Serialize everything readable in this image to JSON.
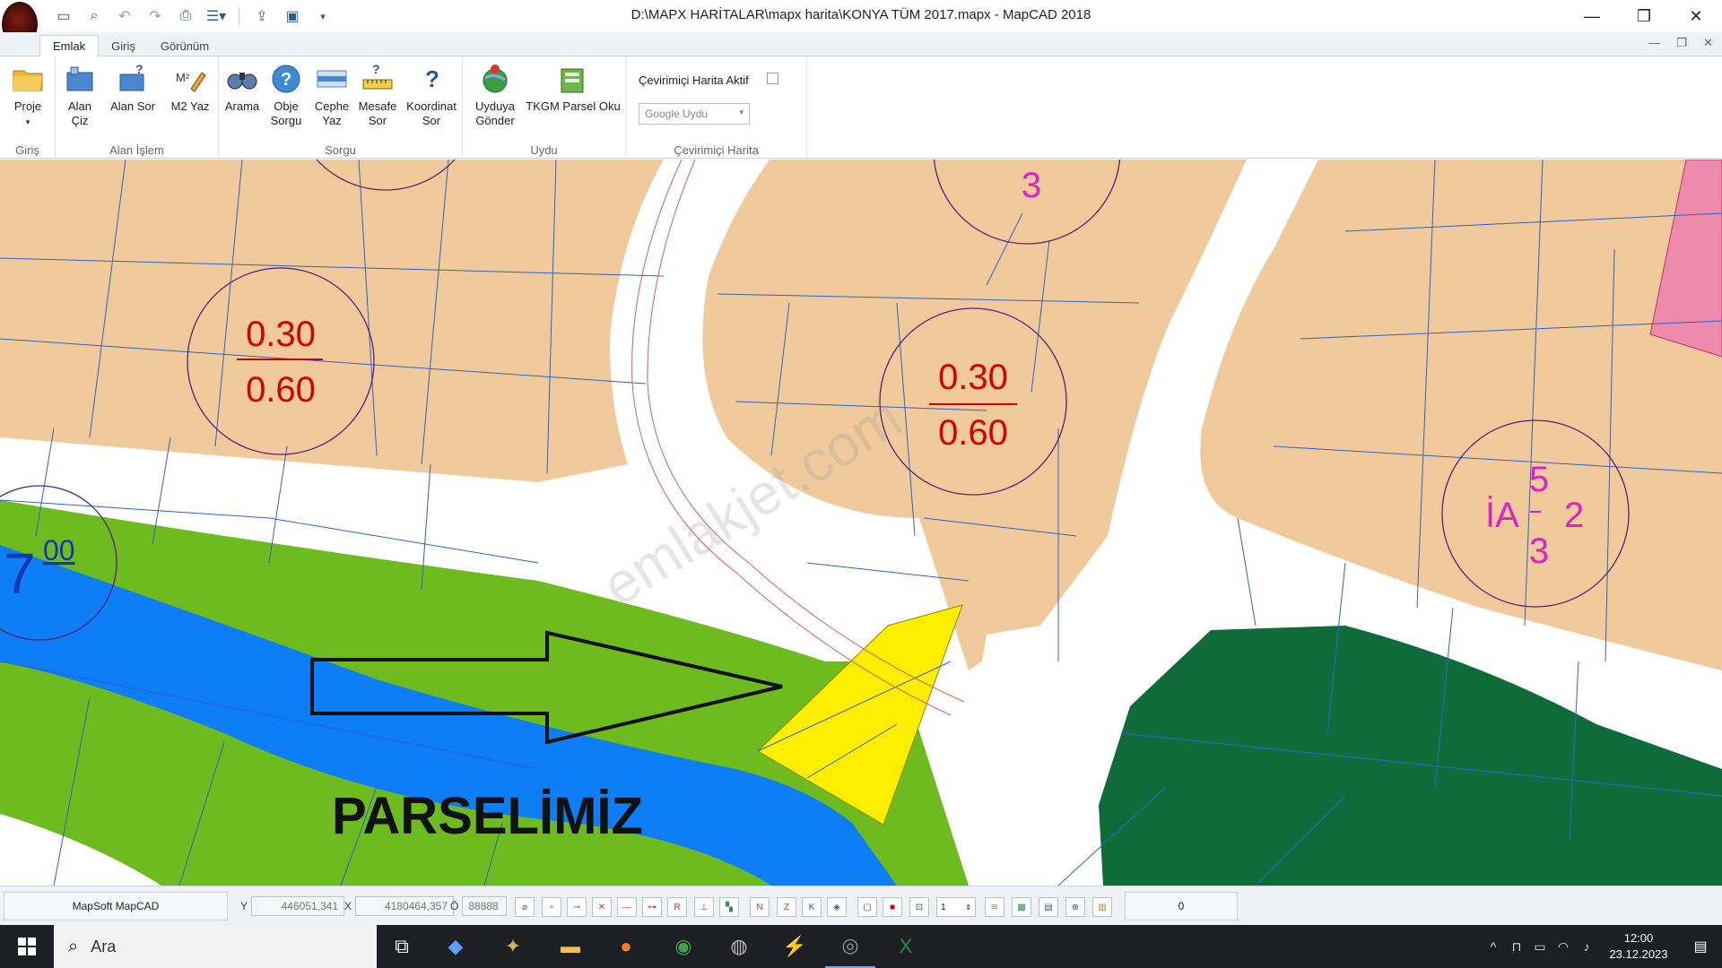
{
  "window": {
    "title": "D:\\MAPX HARİTALAR\\mapx harita\\KONYA TÜM 2017.mapx - MapCAD 2018",
    "minimize": "—",
    "restore": "❐",
    "close": "✕"
  },
  "ribbon_tabs": [
    "Emlak",
    "Giriş",
    "Görünüm"
  ],
  "ribbon": {
    "groups": {
      "giris": "Giriş",
      "alan_islem": "Alan İşlem",
      "sorgu": "Sorgu",
      "uydu": "Uydu",
      "cevrimici": "Çevirimiçi Harita"
    },
    "buttons": {
      "proje": "Proje",
      "alan_ciz": "Alan Çiz",
      "alan_sor": "Alan Sor",
      "m2_yaz": "M2 Yaz",
      "arama": "Arama",
      "obje_sorgu": "Obje Sorgu",
      "cephe_yaz": "Cephe Yaz",
      "mesafe_sor": "Mesafe Sor",
      "koordinat_sor": "Koordinat Sor",
      "uyduya_gonder": "Uyduya Gönder",
      "tkgm_parsel_oku": "TKGM Parsel Oku"
    },
    "online_active_label": "Çevirimiçi Harita Aktif",
    "online_select": "Google Uydu"
  },
  "map": {
    "label_030_left": "0.30",
    "label_060_left": "0.60",
    "label_030_mid": "0.30",
    "label_060_mid": "0.60",
    "label_3_top": "3",
    "label_7": "7",
    "label_00": "00",
    "ia_5": "5",
    "ia_text": "İA",
    "ia_2": "2",
    "ia_3": "3",
    "parcel_label": "PARSELİMİZ",
    "watermark": "emlakjet.com",
    "colors": {
      "residential": "#f0ca9a",
      "park_light": "#6dbb1f",
      "river": "#0d7ef5",
      "forest": "#0f6b3a",
      "highlight": "#ffee00",
      "pink": "#ee8aab",
      "parcel_line": "#2d63c8",
      "label_red": "#d40000",
      "label_magenta": "#e020c8"
    }
  },
  "statusbar": {
    "app_name": "MapSoft MapCAD",
    "y_label": "Y",
    "y_value": "446051,341",
    "x_label": "X",
    "x_value": "4180464,357",
    "o_label": "Ö",
    "o_value": "88888",
    "spinner_value": "1",
    "counter": "0"
  },
  "taskbar": {
    "search_placeholder": "Ara",
    "time": "12:00",
    "date": "23.12.2023"
  }
}
